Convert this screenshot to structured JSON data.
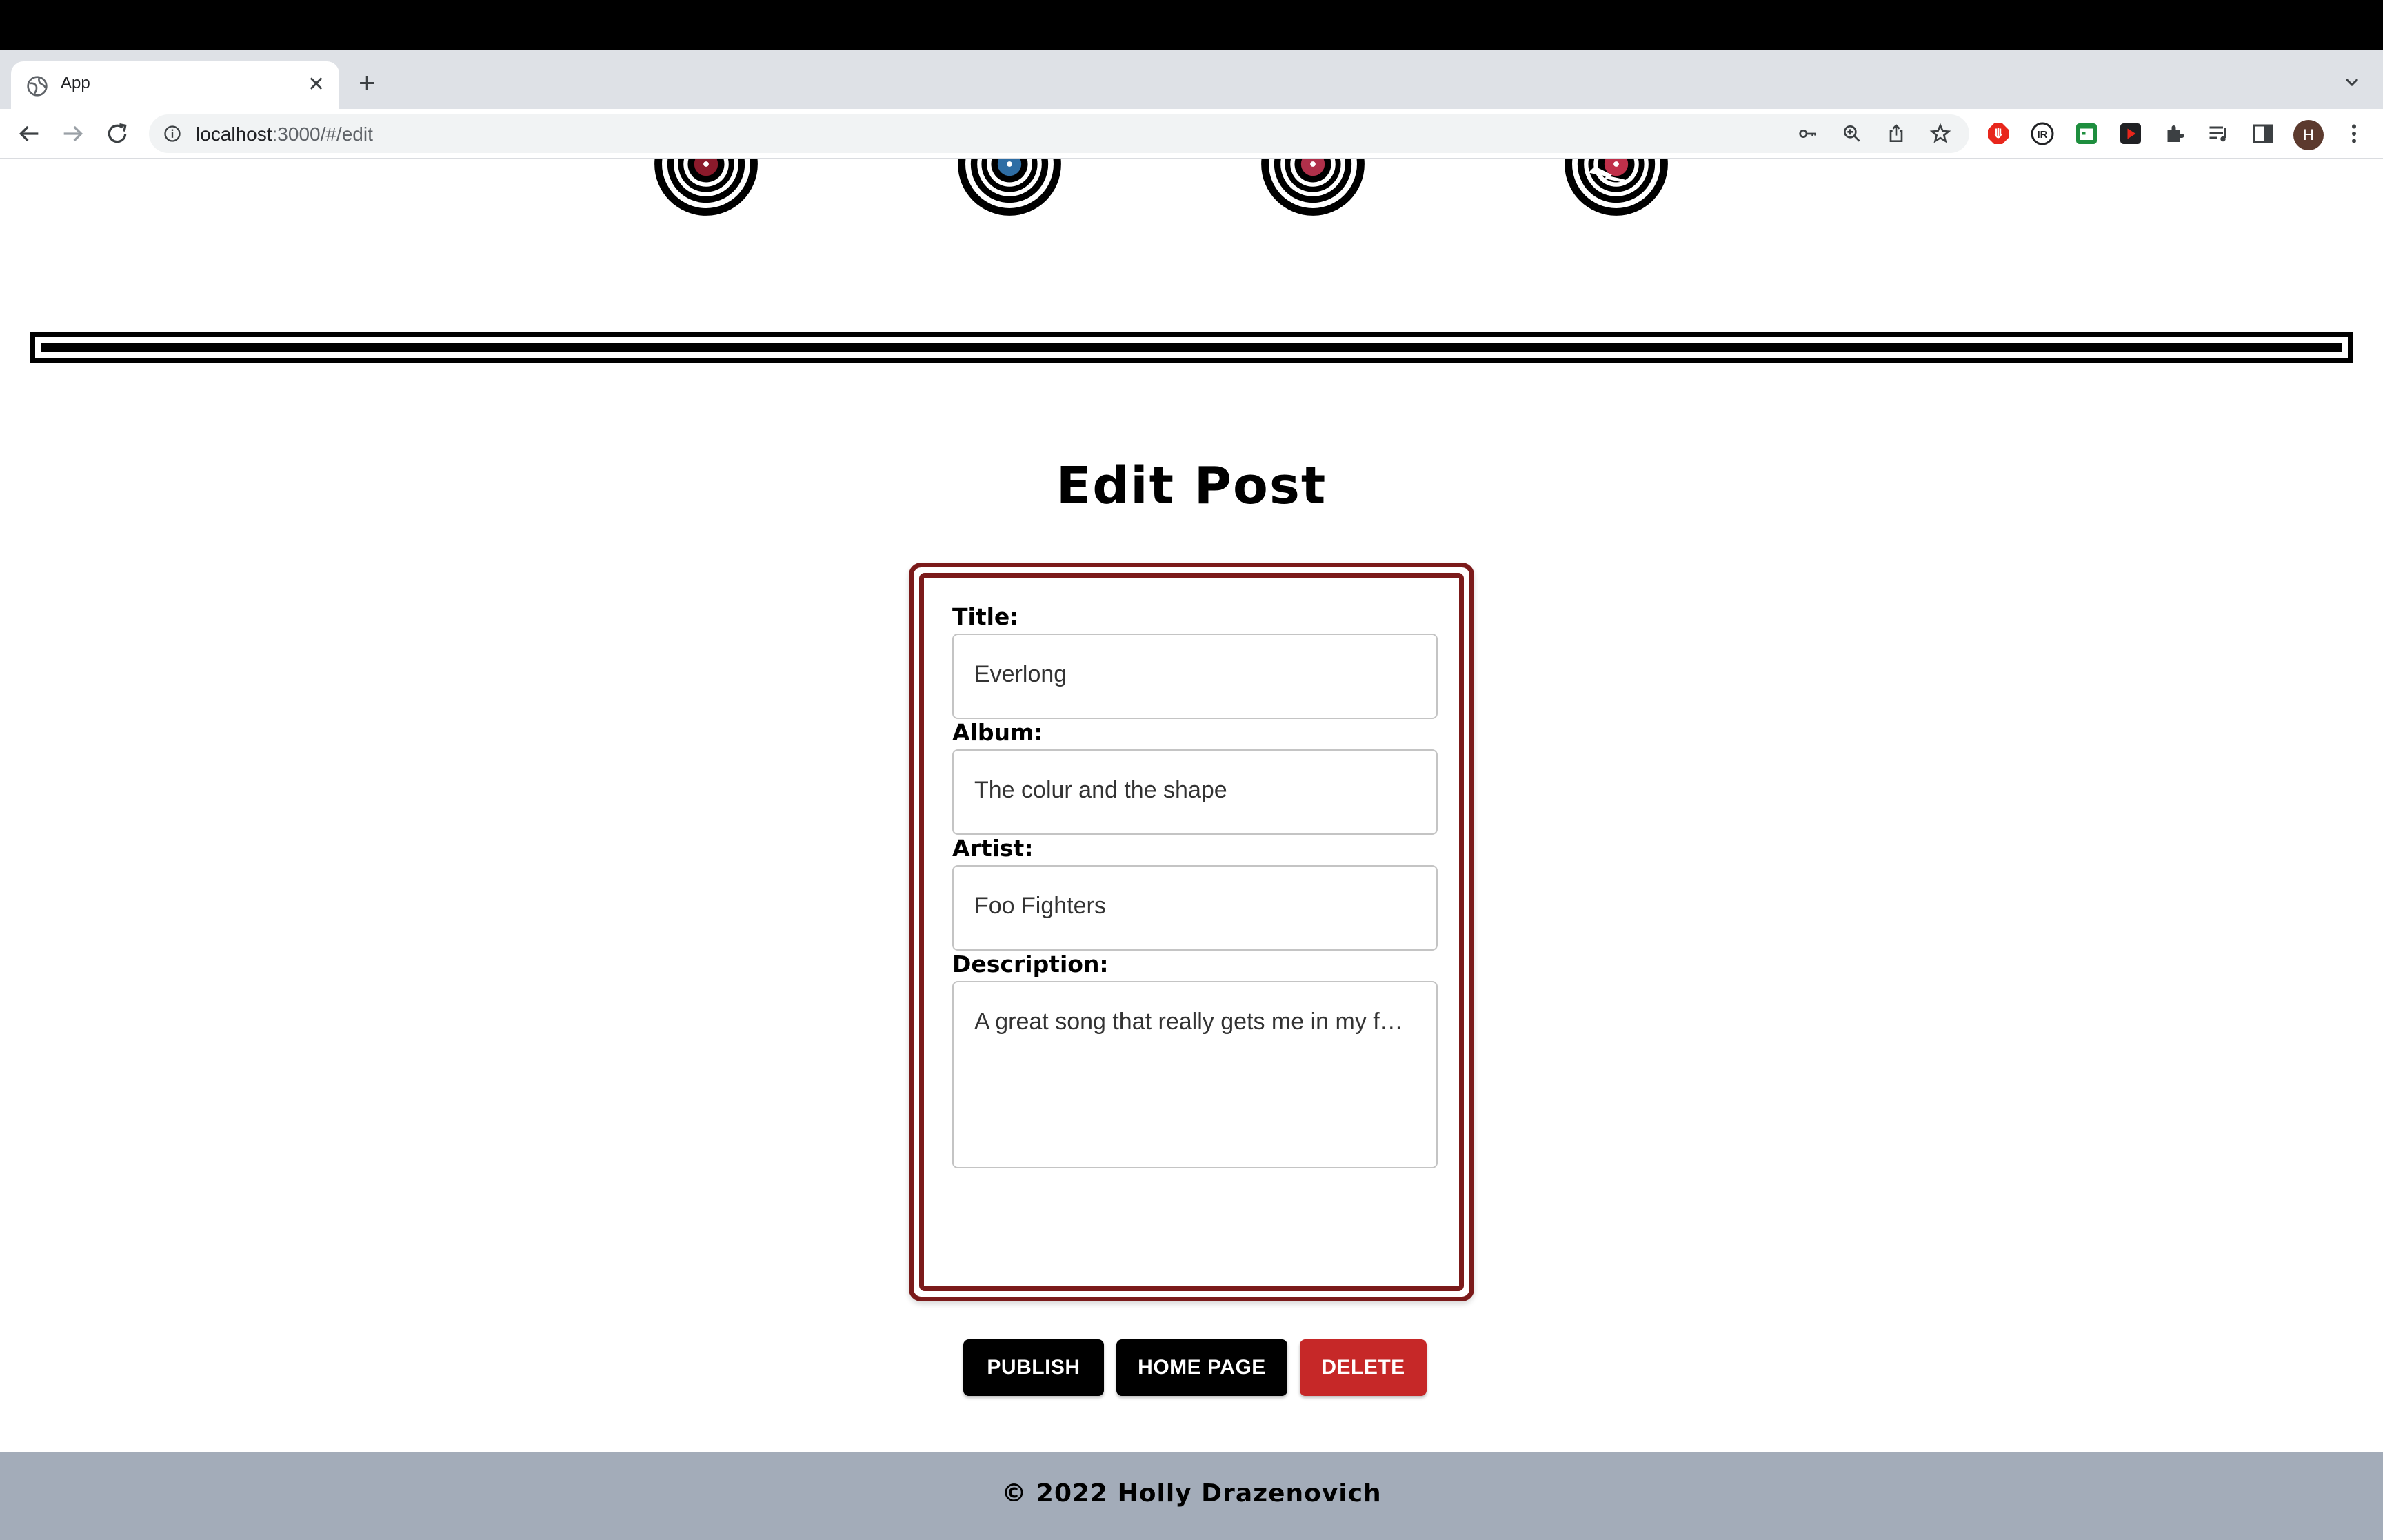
{
  "browser": {
    "tab_title": "App",
    "url_host": "localhost",
    "url_rest": ":3000/#/edit",
    "avatar_initial": "H"
  },
  "header": {
    "records": [
      {
        "label_color": "#8b1a2b"
      },
      {
        "label_color": "#2e6da4"
      },
      {
        "label_color": "#b0304a"
      },
      {
        "label_color": "#c0304a"
      }
    ]
  },
  "page": {
    "title": "Edit Post"
  },
  "form": {
    "title_label": "Title:",
    "title_value": "Everlong",
    "album_label": "Album:",
    "album_value": "The colur and the shape",
    "artist_label": "Artist:",
    "artist_value": "Foo Fighters",
    "description_label": "Description:",
    "description_value": "A great song that really gets me in my f…",
    "publish_label": "PUBLISH",
    "home_label": "HOME PAGE",
    "delete_label": "DELETE"
  },
  "footer": {
    "text": "© 2022 Holly Drazenovich"
  },
  "colors": {
    "card_border": "#7b1a1a",
    "delete_button": "#c62828",
    "footer_bg": "#a3acb9"
  }
}
